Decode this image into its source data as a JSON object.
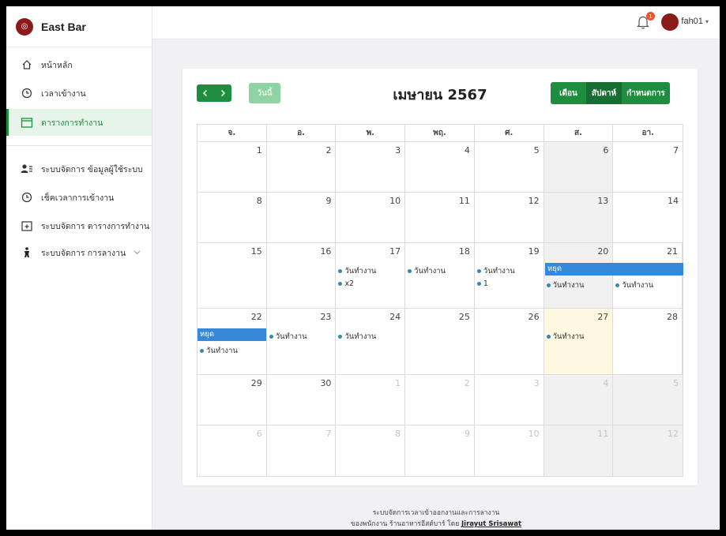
{
  "app": {
    "name": "East Bar"
  },
  "topbar": {
    "notification_count": "1",
    "username": "fah01"
  },
  "sidebar": {
    "items": [
      {
        "label": "หน้าหลัก",
        "icon": "home-icon"
      },
      {
        "label": "เวลาเข้างาน",
        "icon": "clock-icon"
      },
      {
        "label": "ตารางการทำงาน",
        "icon": "calendar-icon",
        "active": true
      },
      {
        "label": "ระบบจัดการ ข้อมูลผู้ใช้ระบบ",
        "icon": "users-list-icon"
      },
      {
        "label": "เช็คเวลาการเข้างาน",
        "icon": "clock-icon"
      },
      {
        "label": "ระบบจัดการ ตารางการทำงาน",
        "icon": "calendar-plus-icon"
      },
      {
        "label": "ระบบจัดการ การลางาน",
        "icon": "walking-person-icon"
      }
    ]
  },
  "calendar": {
    "prev": "‹",
    "next": "›",
    "today_label": "วันนี้",
    "title": "เมษายน 2567",
    "views": [
      "เดือน",
      "สัปดาห์",
      "กำหนดการ"
    ],
    "weekdays": [
      "จ.",
      "อ.",
      "พ.",
      "พฤ.",
      "ศ.",
      "ส.",
      "อา."
    ],
    "weeks": [
      [
        {
          "n": "1"
        },
        {
          "n": "2"
        },
        {
          "n": "3"
        },
        {
          "n": "4"
        },
        {
          "n": "5"
        },
        {
          "n": "6"
        },
        {
          "n": "7"
        }
      ],
      [
        {
          "n": "8"
        },
        {
          "n": "9"
        },
        {
          "n": "10"
        },
        {
          "n": "11"
        },
        {
          "n": "12"
        },
        {
          "n": "13"
        },
        {
          "n": "14"
        }
      ],
      [
        {
          "n": "15"
        },
        {
          "n": "16"
        },
        {
          "n": "17"
        },
        {
          "n": "18"
        },
        {
          "n": "19"
        },
        {
          "n": "20"
        },
        {
          "n": "21"
        }
      ],
      [
        {
          "n": "22"
        },
        {
          "n": "23"
        },
        {
          "n": "24"
        },
        {
          "n": "25"
        },
        {
          "n": "26"
        },
        {
          "n": "27"
        },
        {
          "n": "28"
        }
      ],
      [
        {
          "n": "29"
        },
        {
          "n": "30"
        },
        {
          "n": "1"
        },
        {
          "n": "2"
        },
        {
          "n": "3"
        },
        {
          "n": "4"
        },
        {
          "n": "5"
        }
      ],
      [
        {
          "n": "6"
        },
        {
          "n": "7"
        },
        {
          "n": "8"
        },
        {
          "n": "9"
        },
        {
          "n": "10"
        },
        {
          "n": "11"
        },
        {
          "n": "12"
        }
      ]
    ],
    "events": {
      "workday": "วันทำงาน",
      "holiday": "หยุด",
      "x2": "x2",
      "one": "1"
    },
    "colors": {
      "event_dot": "#3a87ad",
      "holiday_bar": "#3788d8",
      "today_bg": "#fdf8df",
      "accent": "#1e8e3e"
    }
  },
  "footer": {
    "line1": "ระบบจัดการเวลาเข้าออกงานและการลางาน",
    "line2": "ของพนักงาน ร้านอาหารอีสต์บาร์ โดย",
    "author": "Jirayut Srisawat"
  }
}
